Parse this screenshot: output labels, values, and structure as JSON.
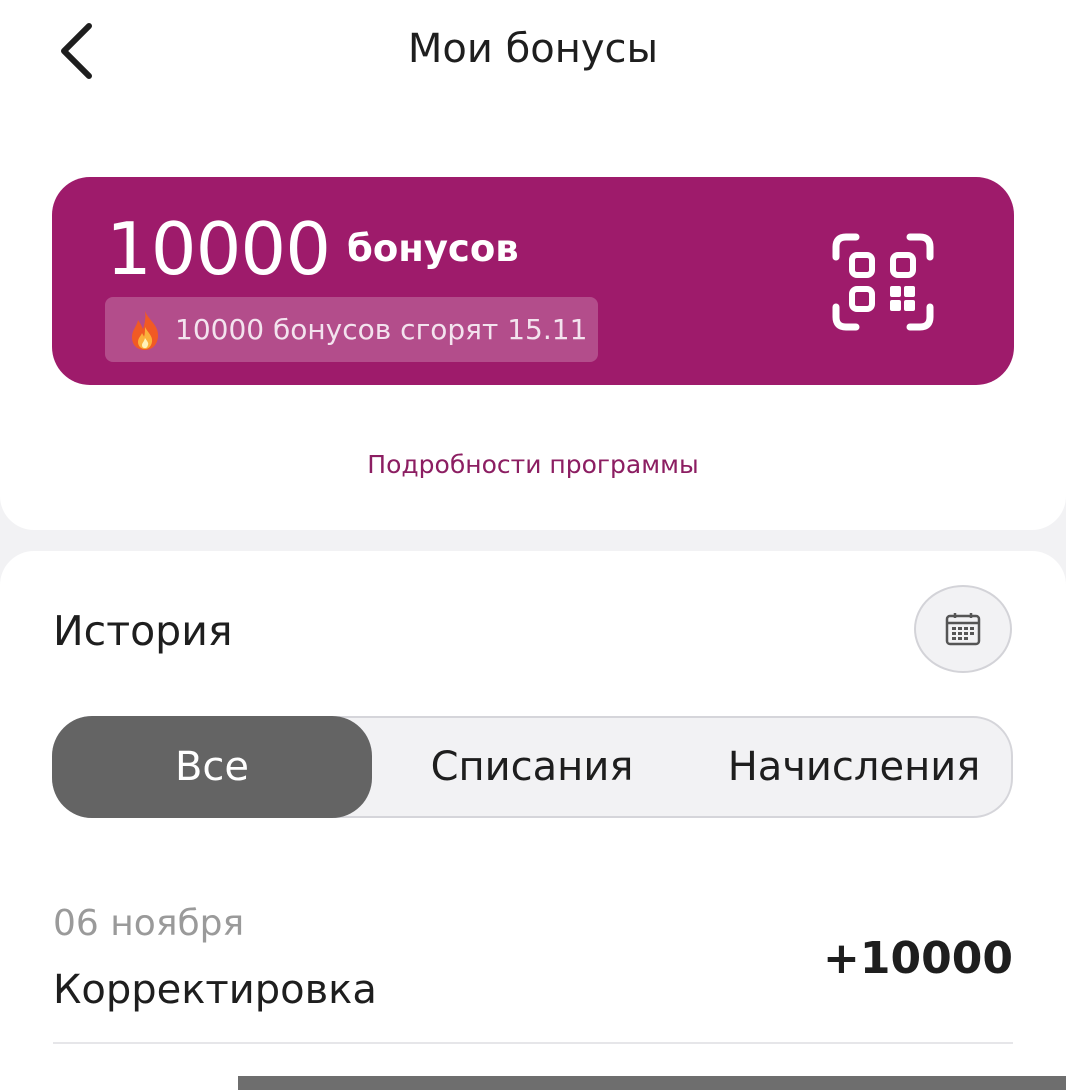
{
  "header": {
    "title": "Мои бонусы",
    "back_icon": "chevron-left-icon"
  },
  "bonus_card": {
    "amount": "10000",
    "unit": "бонусов",
    "expire_text": "10000 бонусов сгорят 15.11",
    "expire_icon": "fire-icon",
    "qr_icon": "qr-code-icon",
    "background_color": "#9e1b6b"
  },
  "program_link": "Подробности программы",
  "history": {
    "title": "История",
    "calendar_icon": "calendar-icon",
    "tabs": [
      {
        "label": "Все",
        "active": true
      },
      {
        "label": "Списания",
        "active": false
      },
      {
        "label": "Начисления",
        "active": false
      }
    ],
    "entries": [
      {
        "date": "06 ноября",
        "description": "Корректировка",
        "amount": "+10000"
      }
    ]
  },
  "colors": {
    "accent": "#9e1b6b",
    "link": "#8c1e62",
    "active_tab": "#646464"
  }
}
